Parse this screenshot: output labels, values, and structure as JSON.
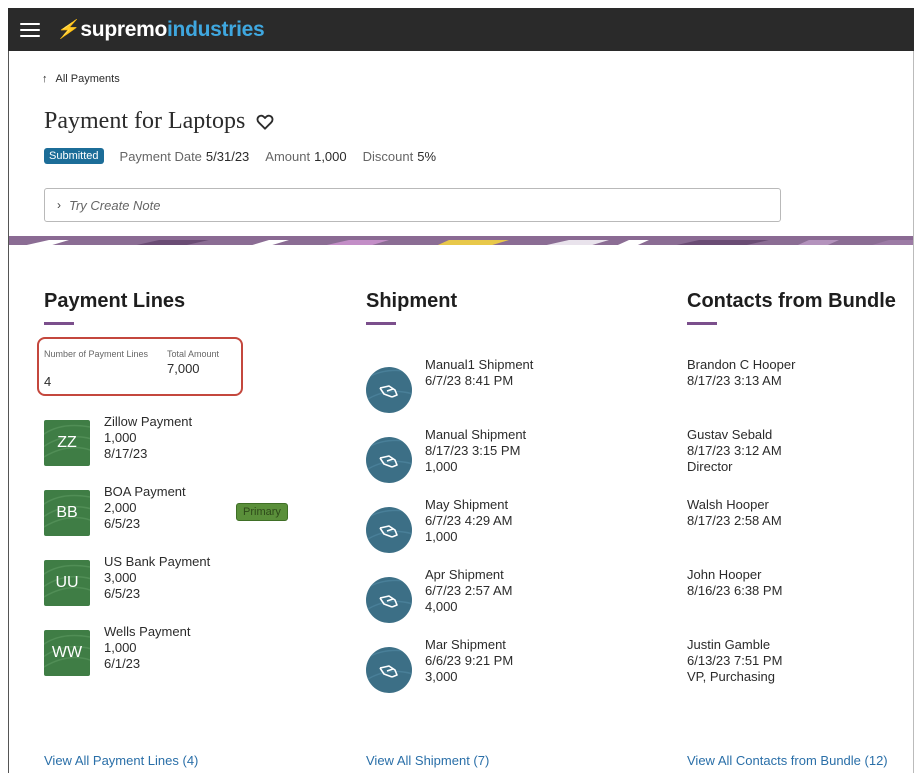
{
  "brand": {
    "part1": "supremo",
    "part2": "industries",
    "bolt_color": "#3fa7df"
  },
  "back_link": {
    "label": "All Payments"
  },
  "title": "Payment for Laptops",
  "meta": {
    "status": "Submitted",
    "payment_date_label": "Payment Date",
    "payment_date": "5/31/23",
    "amount_label": "Amount",
    "amount": "1,000",
    "discount_label": "Discount",
    "discount": "5%"
  },
  "note": {
    "placeholder": "Try Create Note"
  },
  "payment_lines": {
    "title": "Payment Lines",
    "summary": {
      "count_label": "Number of Payment Lines",
      "count": "4",
      "total_label": "Total Amount",
      "total": "7,000"
    },
    "items": [
      {
        "initials": "ZZ",
        "name": "Zillow Payment",
        "amount": "1,000",
        "date": "8/17/23"
      },
      {
        "initials": "BB",
        "name": "BOA Payment",
        "amount": "2,000",
        "date": "6/5/23",
        "badge": "Primary"
      },
      {
        "initials": "UU",
        "name": "US Bank Payment",
        "amount": "3,000",
        "date": "6/5/23"
      },
      {
        "initials": "WW",
        "name": "Wells Payment",
        "amount": "1,000",
        "date": "6/1/23"
      }
    ],
    "view_all": "View All Payment Lines (4)"
  },
  "shipment": {
    "title": "Shipment",
    "items": [
      {
        "name": "Manual1 Shipment",
        "datetime": "6/7/23 8:41 PM",
        "amount": ""
      },
      {
        "name": "Manual Shipment",
        "datetime": "8/17/23 3:15 PM",
        "amount": "1,000"
      },
      {
        "name": "May Shipment",
        "datetime": "6/7/23 4:29 AM",
        "amount": "1,000"
      },
      {
        "name": "Apr Shipment",
        "datetime": "6/7/23 2:57 AM",
        "amount": "4,000"
      },
      {
        "name": "Mar Shipment",
        "datetime": "6/6/23 9:21 PM",
        "amount": "3,000"
      }
    ],
    "view_all": "View All Shipment (7)"
  },
  "contacts": {
    "title": "Contacts from Bundle",
    "items": [
      {
        "name": "Brandon C Hooper",
        "datetime": "8/17/23 3:13 AM",
        "role": ""
      },
      {
        "name": "Gustav Sebald",
        "datetime": "8/17/23 3:12 AM",
        "role": "Director"
      },
      {
        "name": "Walsh Hooper",
        "datetime": "8/17/23 2:58 AM",
        "role": ""
      },
      {
        "name": "John Hooper",
        "datetime": "8/16/23 6:38 PM",
        "role": ""
      },
      {
        "name": "Justin Gamble",
        "datetime": "6/13/23 7:51 PM",
        "role": "VP, Purchasing"
      }
    ],
    "view_all": "View All Contacts from Bundle (12)"
  },
  "colors": {
    "topbar": "#2a2a2a",
    "status_badge": "#1c6d98",
    "avatar_green": "#3f7d45",
    "shipment_icon": "#3c6f86",
    "highlight_border": "#c4473d",
    "link": "#2a6fa8",
    "accent_underline": "#7b4f8c"
  }
}
